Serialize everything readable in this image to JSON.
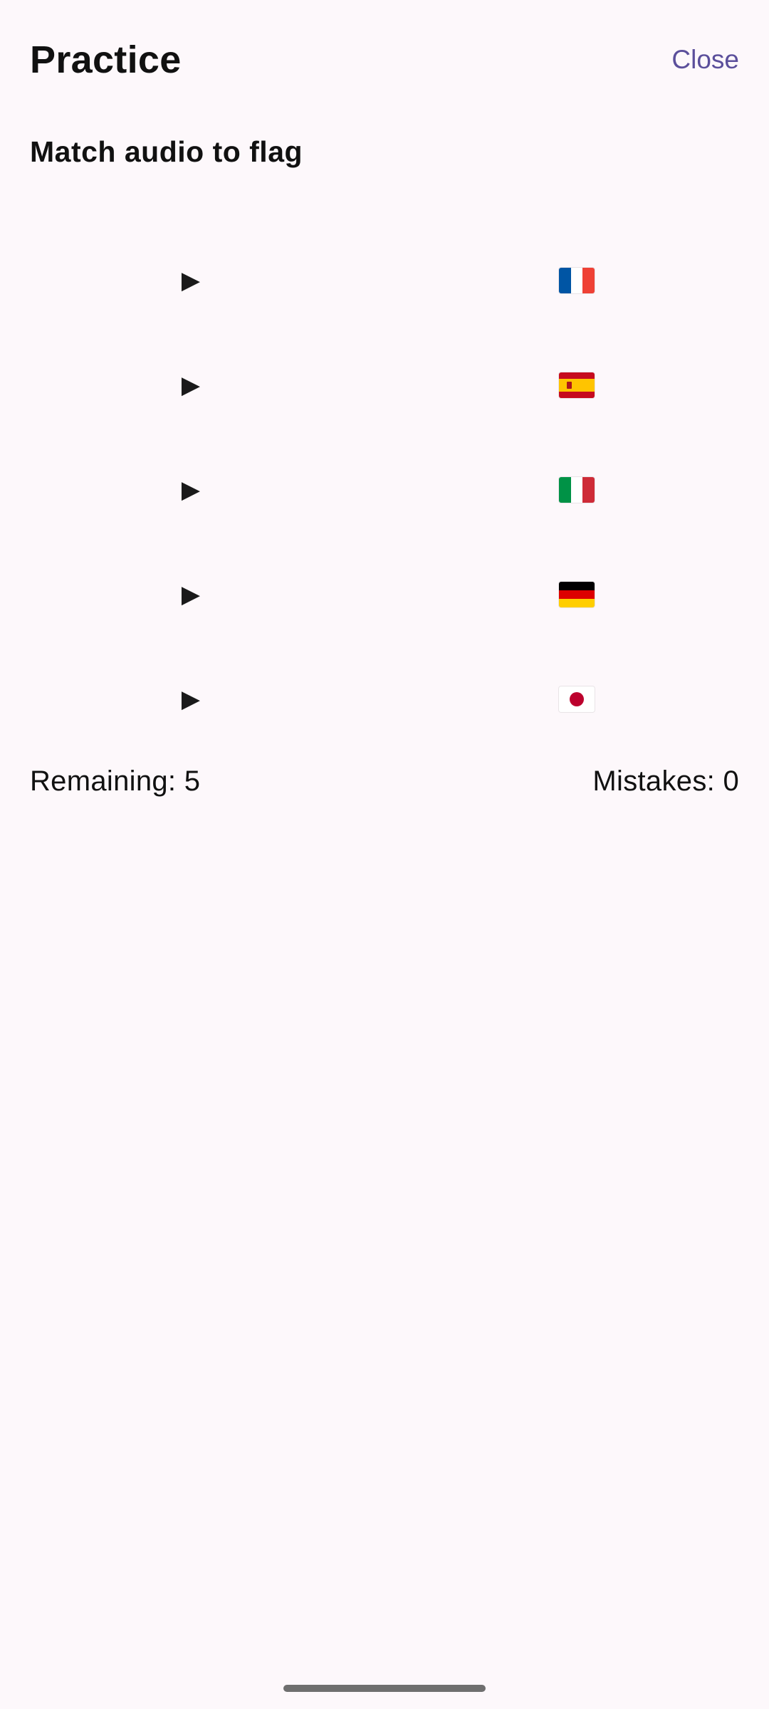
{
  "header": {
    "title": "Practice",
    "close_label": "Close"
  },
  "exercise": {
    "instruction": "Match audio to flag",
    "play_glyph": "▶",
    "audio_buttons": [
      {
        "icon": "play-icon"
      },
      {
        "icon": "play-icon"
      },
      {
        "icon": "play-icon"
      },
      {
        "icon": "play-icon"
      },
      {
        "icon": "play-icon"
      }
    ],
    "flags": [
      {
        "name": "france-flag-icon",
        "colors": [
          "#0055a4",
          "#ffffff",
          "#ef4135"
        ]
      },
      {
        "name": "spain-flag-icon",
        "colors": [
          "#c60b1e",
          "#ffc400",
          "#c60b1e"
        ]
      },
      {
        "name": "italy-flag-icon",
        "colors": [
          "#009246",
          "#ffffff",
          "#ce2b37"
        ]
      },
      {
        "name": "germany-flag-icon",
        "colors": [
          "#000000",
          "#dd0000",
          "#ffce00"
        ]
      },
      {
        "name": "japan-flag-icon",
        "colors": [
          "#ffffff",
          "#bc002d"
        ]
      }
    ]
  },
  "stats": {
    "remaining_label": "Remaining: 5",
    "mistakes_label": "Mistakes: 0"
  },
  "theme": {
    "accent": "#5b4f9b",
    "background": "#fdf8fb"
  }
}
